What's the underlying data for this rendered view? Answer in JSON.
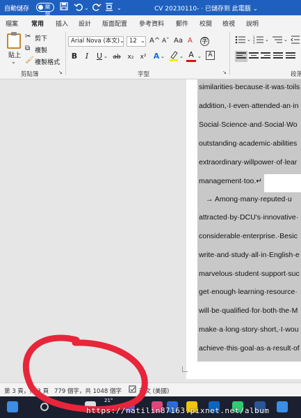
{
  "titlebar": {
    "autosave_label": "自動儲存",
    "autosave_state": "關閉",
    "doc_title": "CV 20230110- · 已儲存到 此電腦 ⌄"
  },
  "tabs": [
    "檔案",
    "常用",
    "插入",
    "設計",
    "版面配置",
    "參考資料",
    "郵件",
    "校閱",
    "檢視",
    "說明"
  ],
  "active_tab": "常用",
  "ribbon": {
    "paste": "貼上",
    "cut": "剪下",
    "copy": "複製",
    "format_painter": "複製格式",
    "clipboard_group": "剪貼簿",
    "font_name": "Arial Nova (本文)",
    "font_size": "12",
    "font_group": "字型",
    "para_group": "段落",
    "bold": "B",
    "italic": "I",
    "underline": "U",
    "strike": "ab",
    "subscript": "x₂",
    "superscript": "x²",
    "grow_font": "A^",
    "shrink_font": "Aˇ",
    "case": "Aa",
    "clear_format": "A",
    "text_effect": "A",
    "font_color": "A",
    "char_border": "A",
    "enclose": "字"
  },
  "document": {
    "lines": [
      "similarities·because·it·was·toils",
      "addition,·I·even·attended·an·in",
      "Social·Science·and·Social·Wo",
      "outstanding·academic·abilities",
      "extraordinary·willpower·of·lear",
      "management·too.↵",
      "→   Among·many·reputed·u",
      "attracted·by·DCU's·innovative·",
      "considerable·enterprise.·Besic",
      "write·and·study·all·in·English·e",
      "marvelous·student·support·suc",
      "get·enough·learning·resource·",
      "will·be·qualified·for·both·the·M",
      "make·a·long·story·short,·I·wou",
      "achieve·this·goal·as·a·result·of"
    ]
  },
  "statusbar": {
    "page": "第 3 頁，共 3 頁",
    "words": "779 個字，共 1048 個字",
    "language": "英文 (美國)"
  },
  "taskbar": {
    "temperature": "21°"
  },
  "watermark": "https://natilin87163.pixnet.net/album",
  "colors": {
    "titlebar": "#1f5fbf",
    "selection": "#c8c8c8",
    "annotation": "#e8253a"
  }
}
